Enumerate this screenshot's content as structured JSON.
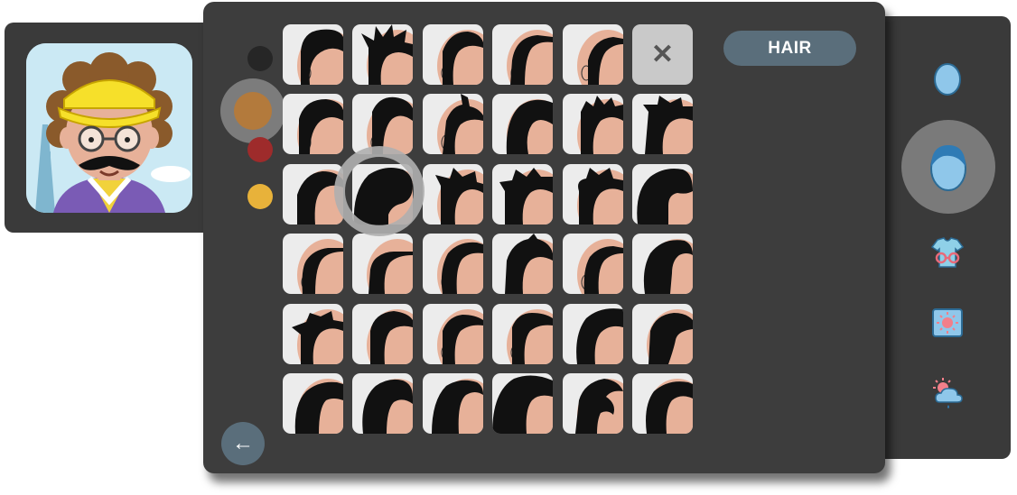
{
  "category": {
    "label": "HAIR"
  },
  "close_glyph": "✕",
  "back_glyph": "←",
  "hair_colors": [
    {
      "name": "black",
      "hex": "#262626",
      "selected": false
    },
    {
      "name": "brown",
      "hex": "#b37a3c",
      "selected": true
    },
    {
      "name": "red",
      "hex": "#9e2b2b",
      "selected": false
    },
    {
      "name": "blonde",
      "hex": "#e8b23a",
      "selected": false
    }
  ],
  "sidebar": {
    "items": [
      {
        "icon": "face-shape-icon",
        "selected": false
      },
      {
        "icon": "hair-icon",
        "selected": true
      },
      {
        "icon": "outfit-icon",
        "selected": false
      },
      {
        "icon": "background-scene-icon",
        "selected": false
      },
      {
        "icon": "weather-icon",
        "selected": false
      }
    ]
  },
  "hair_grid": {
    "rows": 6,
    "columns": 6,
    "selected_tile": {
      "row": 3,
      "column": 2
    },
    "has_none_option": true
  },
  "colors": {
    "accent": "#5a6e7b",
    "panel": "#3d3d3d",
    "skin": "#e7b199",
    "hair": "#111111"
  }
}
